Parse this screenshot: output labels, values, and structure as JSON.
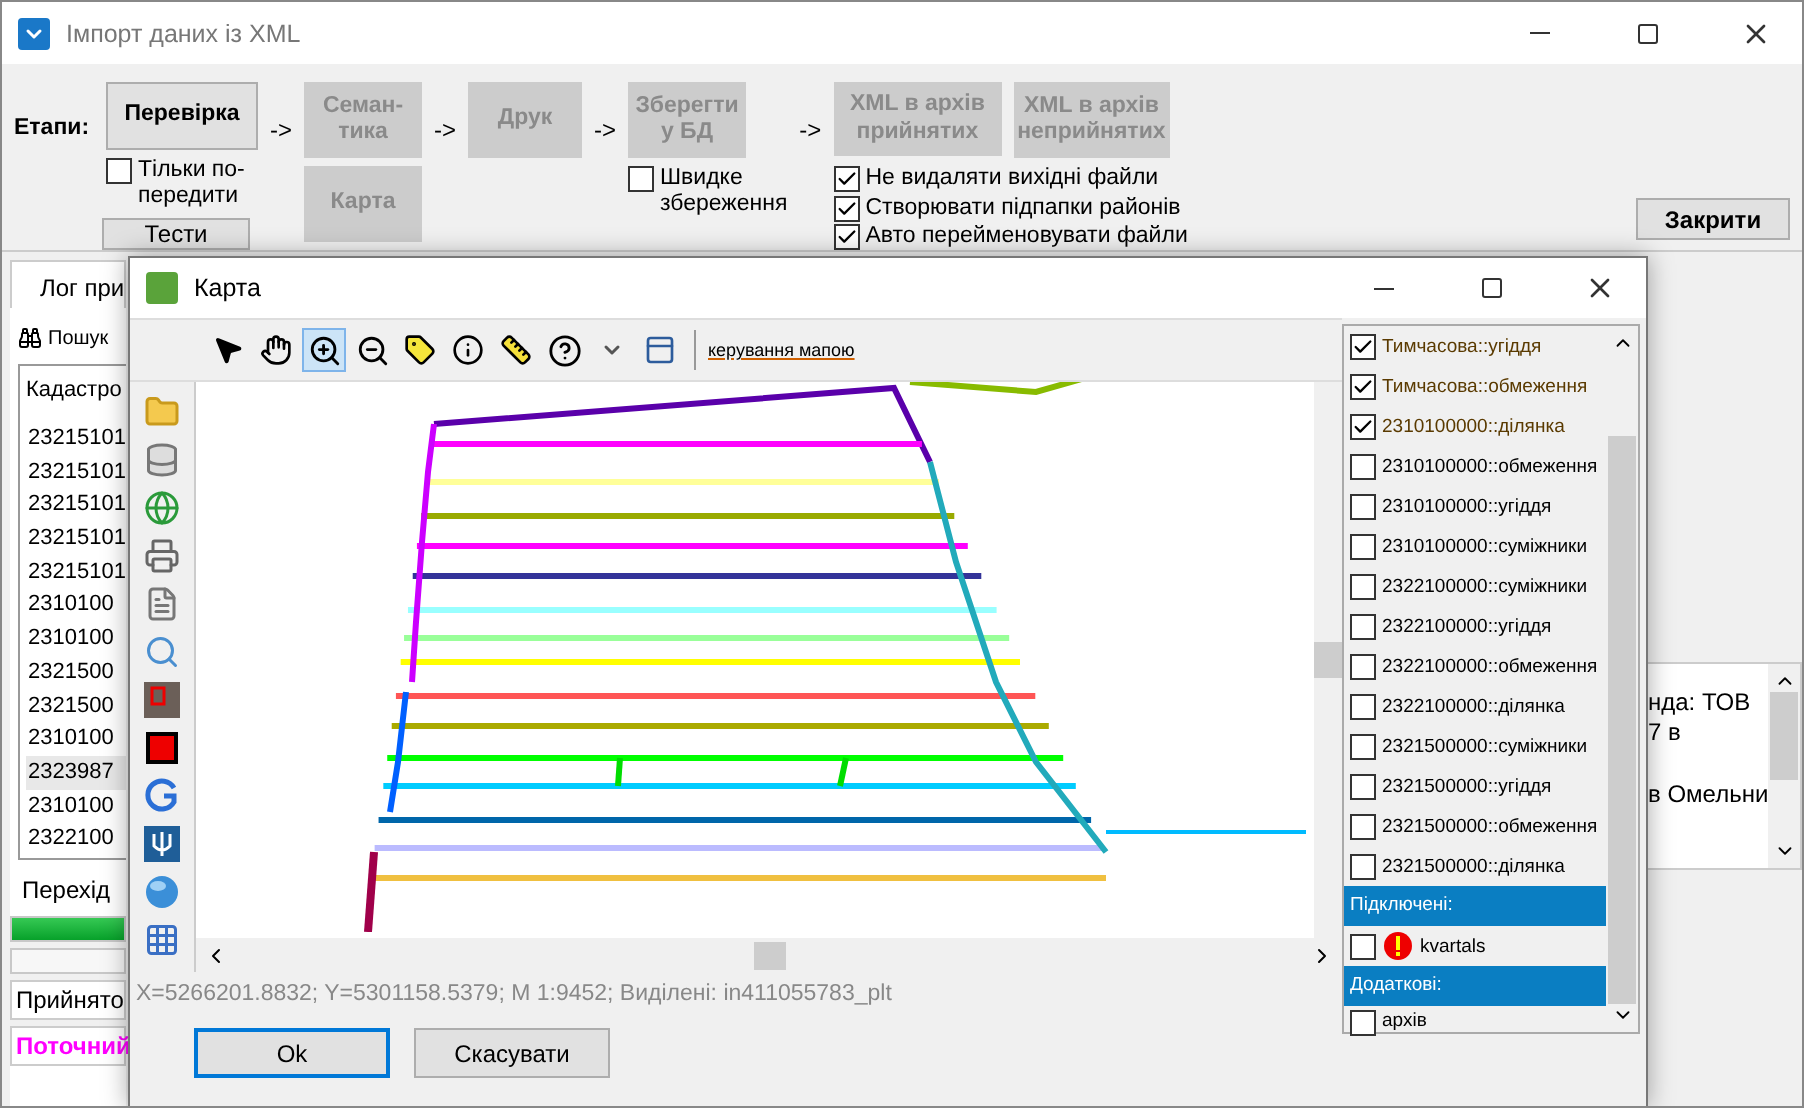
{
  "window": {
    "title": "Імпорт даних із XML"
  },
  "stages": {
    "label": "Етапи:",
    "buttons": [
      {
        "label": "Перевірка",
        "disabled": false,
        "arrow": "->"
      },
      {
        "label": "Семан-\nтика",
        "disabled": true,
        "arrow": "->"
      },
      {
        "label": "Друк",
        "disabled": true,
        "arrow": "->"
      },
      {
        "label": "Зберегти\nу БД",
        "disabled": true,
        "arrow": "->"
      },
      {
        "label": "XML в архів\nприйнятих",
        "disabled": true
      },
      {
        "label": "XML в архів\nнеприйнятих",
        "disabled": true
      }
    ]
  },
  "only_warn": {
    "label": "Тільки по-\nпередити",
    "checked": false
  },
  "tests_button": "Тести",
  "map_button": {
    "label": "Карта",
    "disabled": true
  },
  "quick_save": {
    "label": "Швидке\nзбереження",
    "checked": false
  },
  "file_options": [
    {
      "label": "Не видаляти вихідні файли",
      "checked": true
    },
    {
      "label": "Створювати підпапки районів",
      "checked": true
    },
    {
      "label": "Авто перейменовувати файли",
      "checked": true
    }
  ],
  "close_button": "Закрити",
  "log_tab": "Лог при",
  "search_label": "Пошук",
  "cadastral_list": {
    "header": "Кадастро",
    "rows": [
      {
        "text": "23215101",
        "selected": false
      },
      {
        "text": "23215101",
        "selected": false
      },
      {
        "text": "23215101",
        "selected": false
      },
      {
        "text": "23215101",
        "selected": false
      },
      {
        "text": "23215101",
        "selected": false
      },
      {
        "text": "2310100",
        "selected": false
      },
      {
        "text": "2310100",
        "selected": false
      },
      {
        "text": "2321500",
        "selected": false
      },
      {
        "text": "2321500",
        "selected": false
      },
      {
        "text": "2310100",
        "selected": false
      },
      {
        "text": "2323987",
        "selected": true
      },
      {
        "text": "2310100",
        "selected": false
      },
      {
        "text": "2322100",
        "selected": false
      }
    ]
  },
  "nav_label": "Перехід",
  "progress": [
    {
      "level": 1
    }
  ],
  "accepted_label": "Прийнято",
  "current_label": "Поточний",
  "details": [
    "нда: ТОВ",
    "7 в",
    "в Омельни"
  ],
  "map_dialog": {
    "title": "Карта",
    "tools": [
      {
        "kind": "pointer",
        "selected": false
      },
      {
        "kind": "pan",
        "selected": false
      },
      {
        "kind": "zoom-in",
        "selected": true
      },
      {
        "kind": "zoom-out",
        "selected": false
      },
      {
        "kind": "label",
        "selected": false
      },
      {
        "kind": "info",
        "selected": false
      },
      {
        "kind": "measure",
        "selected": false
      },
      {
        "kind": "help",
        "selected": false
      },
      {
        "kind": "dropdown",
        "selected": false
      },
      {
        "kind": "panel",
        "selected": false
      }
    ],
    "toolbar_link": "керування мапою",
    "layers": [
      {
        "kind": "layer",
        "label": "Тимчасова::угіддя",
        "checked": true
      },
      {
        "kind": "layer",
        "label": "Тимчасова::обмеження",
        "checked": true
      },
      {
        "kind": "layer",
        "label": "2310100000::ділянка",
        "checked": true
      },
      {
        "kind": "layer",
        "label": "2310100000::обмеження",
        "checked": false
      },
      {
        "kind": "layer",
        "label": "2310100000::угіддя",
        "checked": false
      },
      {
        "kind": "layer",
        "label": "2310100000::суміжники",
        "checked": false
      },
      {
        "kind": "layer",
        "label": "2322100000::суміжники",
        "checked": false
      },
      {
        "kind": "layer",
        "label": "2322100000::угіддя",
        "checked": false
      },
      {
        "kind": "layer",
        "label": "2322100000::обмеження",
        "checked": false
      },
      {
        "kind": "layer",
        "label": "2322100000::ділянка",
        "checked": false
      },
      {
        "kind": "layer",
        "label": "2321500000::суміжники",
        "checked": false
      },
      {
        "kind": "layer",
        "label": "2321500000::угіддя",
        "checked": false
      },
      {
        "kind": "layer",
        "label": "2321500000::обмеження",
        "checked": false
      },
      {
        "kind": "layer",
        "label": "2321500000::ділянка",
        "checked": false
      },
      {
        "kind": "header",
        "label": "Підключені:"
      },
      {
        "kind": "warning",
        "label": "kvartals",
        "checked": false
      },
      {
        "kind": "header",
        "label": "Додаткові:"
      },
      {
        "kind": "layer",
        "label": "архів",
        "checked": false
      }
    ],
    "status": "X=5266201.8832; Y=5301158.5379; M 1:9452; Виділені: in411055783_plt",
    "buttons": [
      {
        "label": "Ok",
        "focused": true
      },
      {
        "label": "Скасувати",
        "focused": false
      }
    ]
  }
}
